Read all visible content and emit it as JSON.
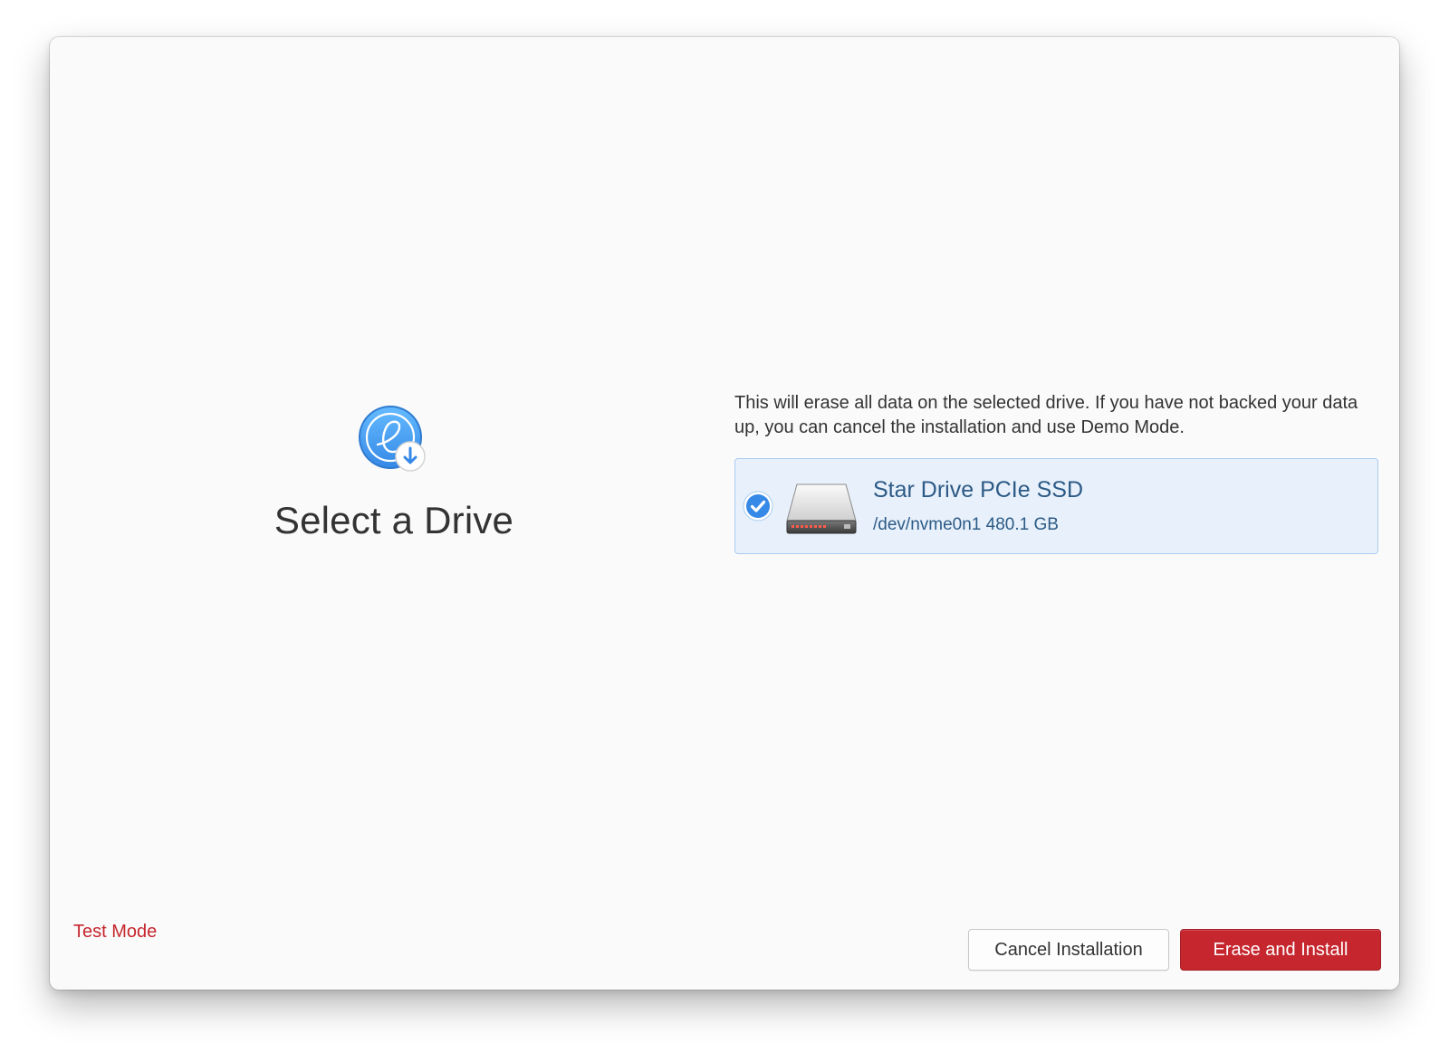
{
  "page": {
    "title": "Select a Drive",
    "warning": "This will erase all data on the selected drive. If you have not backed your data up, you can cancel the installation and use Demo Mode."
  },
  "drive": {
    "name": "Star Drive PCIe SSD",
    "detail": "/dev/nvme0n1 480.1 GB",
    "selected": true,
    "icon": "hard-drive-icon"
  },
  "footer": {
    "test_mode": "Test Mode",
    "cancel_label": "Cancel Installation",
    "erase_label": "Erase and Install"
  },
  "colors": {
    "accent_blue": "#3689e6",
    "destructive_red": "#c6262e",
    "selected_bg": "#e8f1fb"
  },
  "icons": {
    "logo": "installer-logo-icon",
    "check": "check-circle-icon",
    "drive": "hard-drive-icon"
  }
}
